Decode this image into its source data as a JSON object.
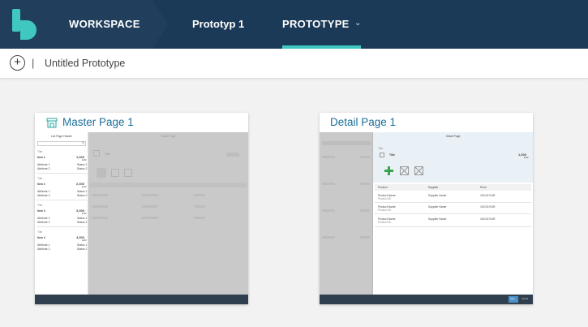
{
  "topbar": {
    "workspace_label": "WORKSPACE",
    "prototype_name": "Prototyp 1",
    "prototype_tab": "PROTOTYPE",
    "colors": {
      "bar": "#1b3a57",
      "chevron": "#213f5c",
      "accent": "#3fc7c0",
      "logo": "#3fc7c0"
    }
  },
  "subbar": {
    "separator": "|",
    "title": "Untitled Prototype"
  },
  "cards": [
    {
      "title": "Master Page 1",
      "thumb": {
        "list_header": "List Page Header",
        "detail_header": "Detail Page",
        "detail_title": "Title",
        "items": [
          {
            "title": "Title",
            "name": "Item 1",
            "value": "1,000",
            "unit": "EUR",
            "attr1": "Attribute 1",
            "status1": "Status 1",
            "attr2": "Attribute 2",
            "status2": "Status 2"
          },
          {
            "title": "Title",
            "name": "Item 2",
            "value": "2,000",
            "unit": "EUR",
            "attr1": "Attribute 1",
            "status1": "Status 1",
            "attr2": "Attribute 2",
            "status2": "Status 2"
          },
          {
            "title": "Title",
            "name": "Item 3",
            "value": "3,000",
            "unit": "EUR",
            "attr1": "Attribute 1",
            "status1": "Status 1",
            "attr2": "Attribute 2",
            "status2": "Status 2"
          },
          {
            "title": "Title",
            "name": "Item 4",
            "value": "4,000",
            "unit": "EUR",
            "attr1": "Attribute 1",
            "status1": "Status 1",
            "attr2": "Attribute 2",
            "status2": "Status 2"
          }
        ]
      }
    },
    {
      "title": "Detail Page 1",
      "thumb": {
        "header": "Detail Page",
        "section_label": "Title",
        "object_title": "Title",
        "object_value": "1,000",
        "object_unit": "EUR",
        "columns": [
          "Product",
          "Supplier",
          "Price"
        ],
        "rows": [
          {
            "product": "Product Name",
            "product_id": "Product ID",
            "supplier": "Supplier Name",
            "price": "100.00 EUR"
          },
          {
            "product": "Product Name",
            "product_id": "Product ID",
            "supplier": "Supplier Name",
            "price": "100.00 EUR"
          },
          {
            "product": "Product Name",
            "product_id": "Product ID",
            "supplier": "Supplier Name",
            "price": "100.00 EUR"
          }
        ],
        "save_label": "Save",
        "cancel_label": "Cancel"
      }
    }
  ]
}
